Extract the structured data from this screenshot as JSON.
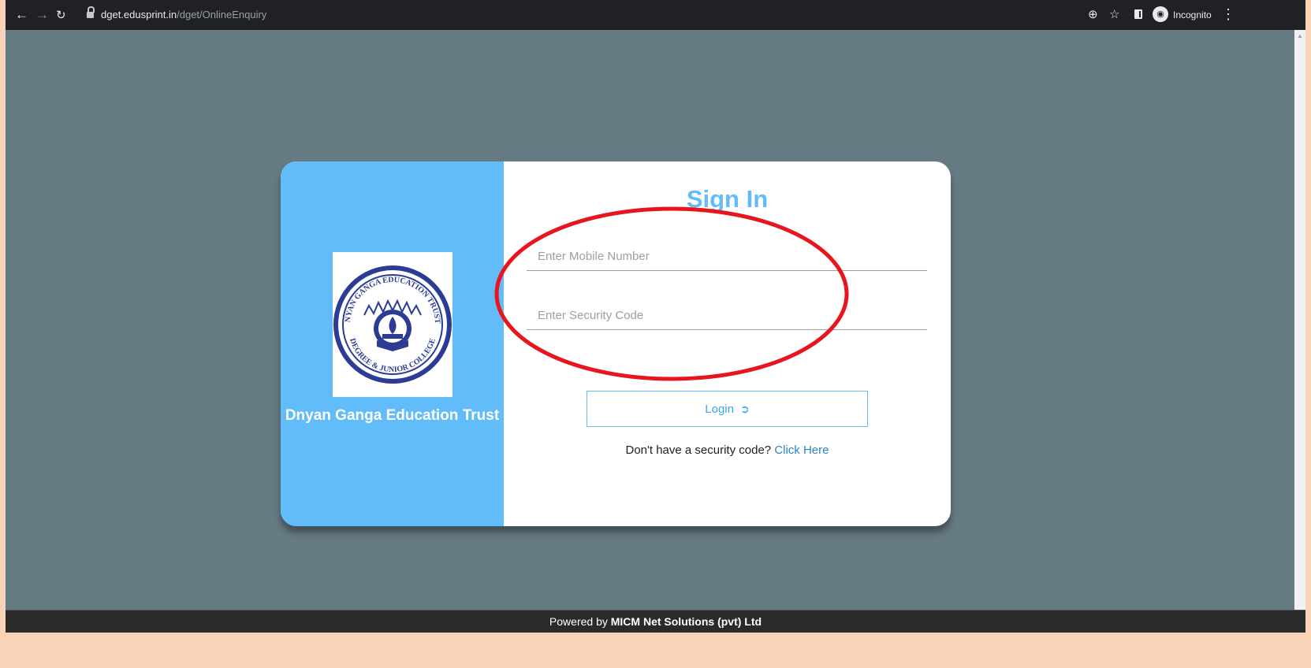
{
  "browser": {
    "url_host": "dget.edusprint.in",
    "url_path": "/dget/OnlineEnquiry",
    "incognito_label": "Incognito",
    "icons": [
      "back-icon",
      "forward-icon",
      "reload-icon",
      "lock-icon",
      "zoom-icon",
      "star-icon",
      "side-panel-icon",
      "incognito-icon",
      "kebab-menu-icon"
    ]
  },
  "card": {
    "org_name": "Dnyan Ganga Education Trust",
    "logo": {
      "ring_top": "DNYAN GANGA EDUCATION TRUSTS",
      "ring_bottom": "DEGREE & JUNIOR COLLEGE"
    },
    "title": "Sign In",
    "mobile_placeholder": "Enter Mobile Number",
    "security_placeholder": "Enter Security Code",
    "login_label": "Login",
    "hint_text": "Don't have a security code?",
    "hint_link": "Click Here"
  },
  "footer": {
    "prefix": "Powered by",
    "company": "MICM Net Solutions (pvt) Ltd"
  },
  "colors": {
    "accent": "#62bcf9",
    "page_bg": "#667a84",
    "highlight": "#e8141e"
  }
}
